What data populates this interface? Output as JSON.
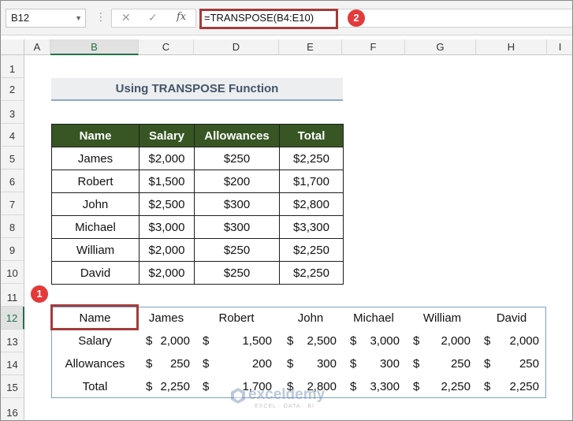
{
  "formula_bar": {
    "name_box": "B12",
    "cancel_icon": "✕",
    "enter_icon": "✓",
    "fx_label": "fx",
    "formula": "=TRANSPOSE(B4:E10)",
    "badge_2": "2"
  },
  "columns": [
    "A",
    "B",
    "C",
    "D",
    "E",
    "F",
    "G",
    "H",
    "I"
  ],
  "rows": [
    "1",
    "2",
    "3",
    "4",
    "5",
    "6",
    "7",
    "8",
    "9",
    "10",
    "11",
    "12",
    "13",
    "14",
    "15",
    "16"
  ],
  "title": "Using TRANSPOSE Function",
  "source_table": {
    "headers": [
      "Name",
      "Salary",
      "Allowances",
      "Total"
    ],
    "rows": [
      [
        "James",
        "$2,000",
        "$250",
        "$2,250"
      ],
      [
        "Robert",
        "$1,500",
        "$200",
        "$1,700"
      ],
      [
        "John",
        "$2,500",
        "$300",
        "$2,800"
      ],
      [
        "Michael",
        "$3,000",
        "$300",
        "$3,300"
      ],
      [
        "William",
        "$2,000",
        "$250",
        "$2,250"
      ],
      [
        "David",
        "$2,000",
        "$250",
        "$2,250"
      ]
    ]
  },
  "result": {
    "badge_1": "1",
    "row1": [
      "Name",
      "James",
      "Robert",
      "John",
      "Michael",
      "William",
      "David"
    ],
    "labels": [
      "Salary",
      "Allowances",
      "Total"
    ],
    "values": [
      [
        "2,000",
        "1,500",
        "2,500",
        "3,000",
        "2,000",
        "2,000"
      ],
      [
        "250",
        "200",
        "300",
        "300",
        "250",
        "250"
      ],
      [
        "2,250",
        "1,700",
        "2,800",
        "3,300",
        "2,250",
        "2,250"
      ]
    ],
    "currency": "$"
  },
  "watermark": {
    "name": "exceldemy",
    "tagline": "EXCEL · DATA · BI"
  }
}
